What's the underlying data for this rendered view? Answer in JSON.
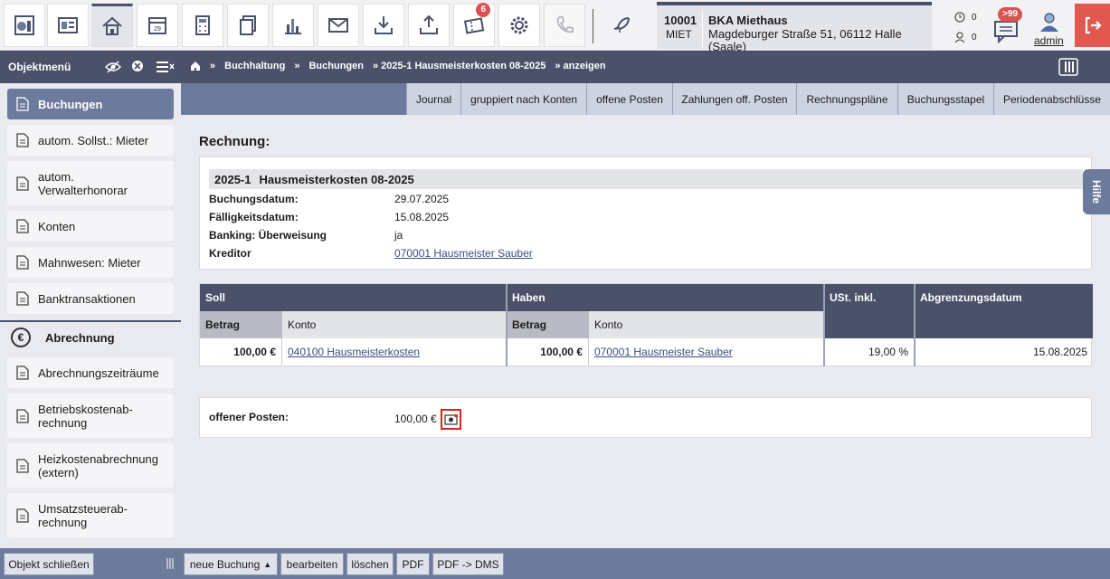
{
  "toolbar": {
    "icons": [
      "dashboard-icon",
      "contacts-icon",
      "home-icon",
      "calendar-icon",
      "calculator-icon",
      "copy-icon",
      "chart-icon",
      "mail-icon",
      "download-icon",
      "upload-icon",
      "ticket-icon",
      "settings-icon",
      "phone-icon",
      "rocket-icon"
    ],
    "calendar_day": "29",
    "ticket_badge": "6"
  },
  "object": {
    "number": "10001",
    "type": "MIET",
    "name": "BKA Miethaus",
    "address": "Magdeburger Straße 51, 06112 Halle (Saale)"
  },
  "counters": {
    "top": "0",
    "bottom": "0"
  },
  "messages_badge": ">99",
  "user": {
    "name": "admin"
  },
  "nav": {
    "objmenu_label": "Objektmenü",
    "breadcrumb": [
      "»",
      "Buchhaltung",
      "»",
      "Buchungen",
      "» 2025-1 Hausmeisterkosten 08-2025",
      "» anzeigen"
    ]
  },
  "sidebar": {
    "items": [
      {
        "label": "Buchungen"
      },
      {
        "label": "autom. Sollst.: Mieter"
      },
      {
        "label": "autom. Verwalterhonorar"
      },
      {
        "label": "Konten"
      },
      {
        "label": "Mahnwesen: Mieter"
      },
      {
        "label": "Banktransaktionen"
      }
    ],
    "section": "Abrechnung",
    "section_items": [
      {
        "label": "Abrechnungszeiträume"
      },
      {
        "label": "Betriebskostenab-rechnung"
      },
      {
        "label": "Heizkostenabrechnung (extern)"
      },
      {
        "label": "Umsatzsteuerab-rechnung"
      }
    ]
  },
  "tabs": [
    "Journal",
    "gruppiert nach Konten",
    "offene Posten",
    "Zahlungen off. Posten",
    "Rechnungspläne",
    "Buchungsstapel",
    "Periodenabschlüsse"
  ],
  "main": {
    "title": "Rechnung:",
    "header_id": "2025-1",
    "header_title": "Hausmeisterkosten 08-2025",
    "fields": [
      {
        "key": "Buchungsdatum:",
        "value": "29.07.2025"
      },
      {
        "key": "Fälligkeitsdatum:",
        "value": "15.08.2025"
      },
      {
        "key": "Banking: Überweisung",
        "value": "ja"
      },
      {
        "key": "Kreditor",
        "value": "070001 Hausmeister Sauber"
      }
    ]
  },
  "booking_table": {
    "soll": "Soll",
    "haben": "Haben",
    "ust": "USt. inkl.",
    "abgrenzung": "Abgrenzungsdatum",
    "betrag": "Betrag",
    "konto": "Konto",
    "row": {
      "soll_betrag": "100,00 €",
      "soll_konto": "040100 Hausmeisterkosten",
      "haben_betrag": "100,00 €",
      "haben_konto": "070001 Hausmeister Sauber",
      "ust": "19,00 %",
      "abgrenzung": "15.08.2025"
    }
  },
  "open_item": {
    "label": "offener Posten:",
    "value": "100,00 €"
  },
  "help_label": "Hilfe",
  "bottom": {
    "close_object": "Objekt schließen",
    "new_booking": "neue Buchung",
    "edit": "bearbeiten",
    "delete": "löschen",
    "pdf": "PDF",
    "pdf_dms": "PDF -> DMS"
  },
  "colors": {
    "nav": "#4a5169",
    "accent": "#6c7a9c",
    "logout": "#e0584f",
    "highlight": "#e02020"
  }
}
